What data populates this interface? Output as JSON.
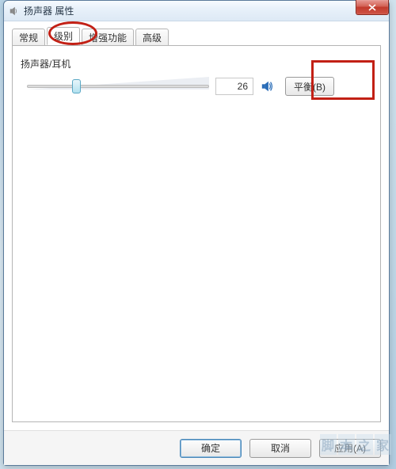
{
  "window": {
    "title": "扬声器 属性"
  },
  "tabs": {
    "items": [
      {
        "label": "常规"
      },
      {
        "label": "级别"
      },
      {
        "label": "增强功能"
      },
      {
        "label": "高级"
      }
    ],
    "activeIndex": 1
  },
  "level": {
    "group_label": "扬声器/耳机",
    "value": "26",
    "slider_percent": 26,
    "balance_label": "平衡(B)"
  },
  "footer": {
    "ok": "确定",
    "cancel": "取消",
    "apply": "应用(A)"
  },
  "icons": {
    "close": "close-icon",
    "speaker": "speaker-icon",
    "app": "speaker-app-icon"
  }
}
